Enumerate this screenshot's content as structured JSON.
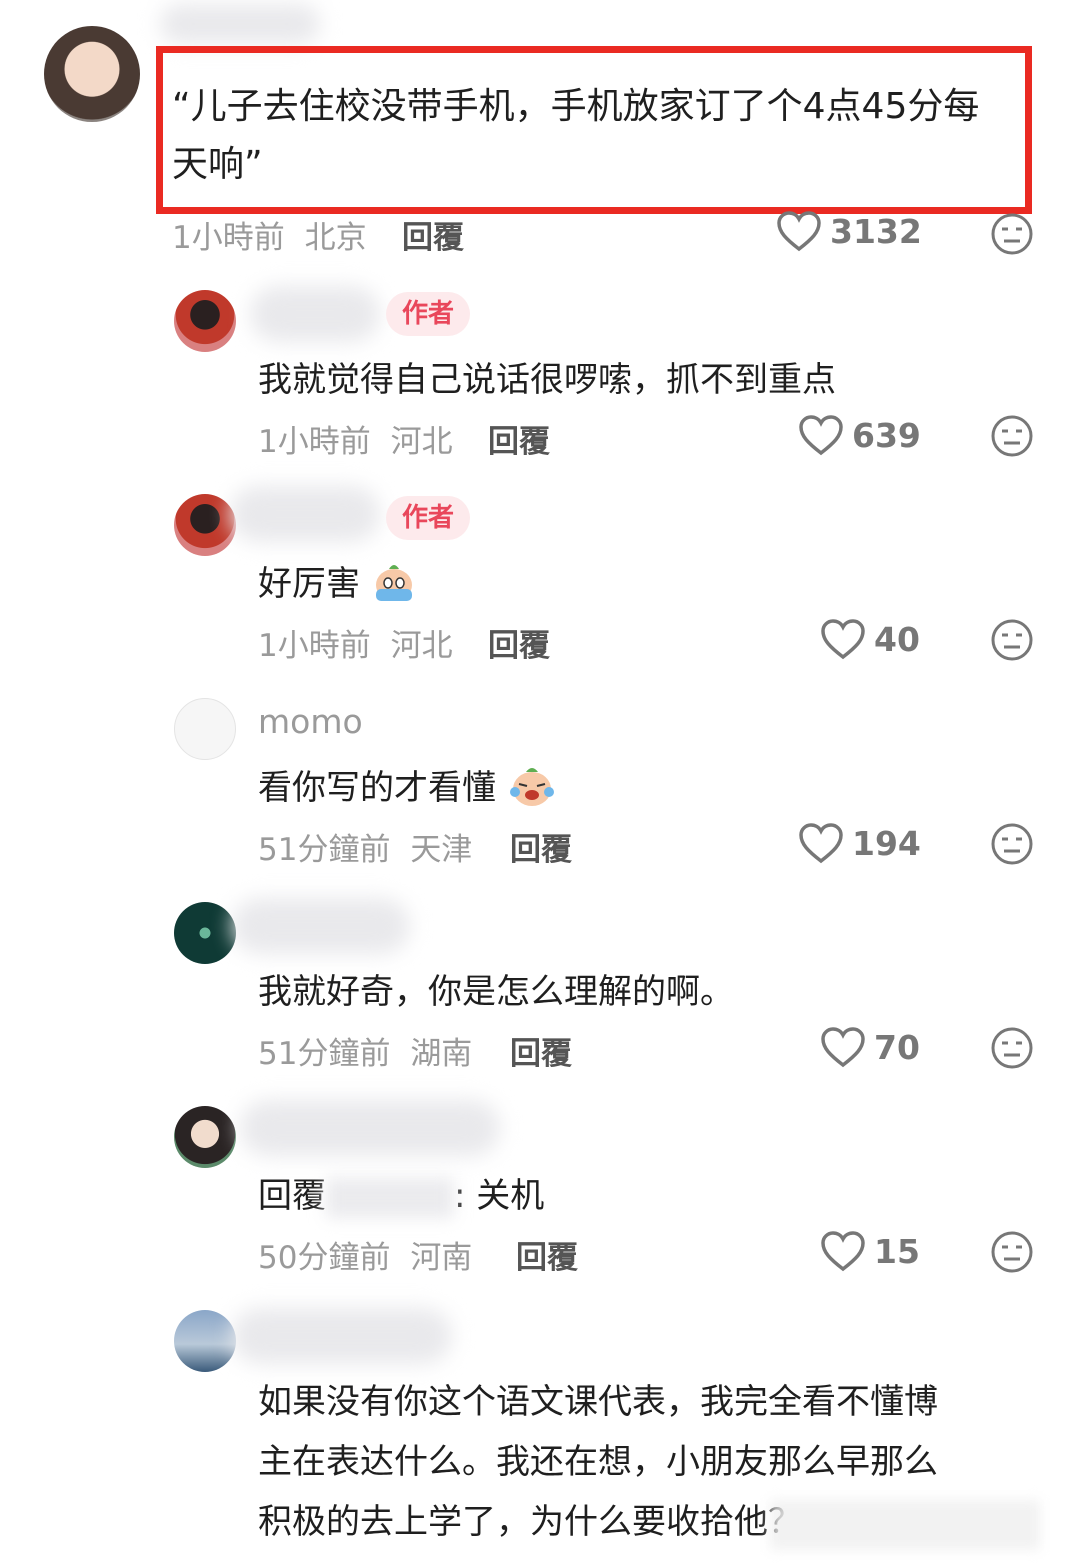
{
  "top_comment": {
    "text_line1": "“儿子去住校没带手机，手机放家订了个4点45分每",
    "text_line2": "天响”",
    "time": "1小時前",
    "location": "北京",
    "reply_label": "回覆",
    "likes": "3132"
  },
  "replies": [
    {
      "badge": "作者",
      "text": "我就觉得自己说话很啰嗦，抓不到重点",
      "time": "1小時前",
      "location": "河北",
      "reply_label": "回覆",
      "likes": "639"
    },
    {
      "badge": "作者",
      "text": "好厉害",
      "time": "1小時前",
      "location": "河北",
      "reply_label": "回覆",
      "likes": "40"
    },
    {
      "username": "momo",
      "text": "看你写的才看懂",
      "time": "51分鐘前",
      "location": "天津",
      "reply_label": "回覆",
      "likes": "194"
    },
    {
      "text": "我就好奇，你是怎么理解的啊。",
      "time": "51分鐘前",
      "location": "湖南",
      "reply_label": "回覆",
      "likes": "70"
    },
    {
      "text_prefix": "回覆",
      "text_suffix": ": 关机",
      "time": "50分鐘前",
      "location": "河南",
      "reply_label": "回覆",
      "likes": "15"
    },
    {
      "text_line1": "如果没有你这个语文课代表，我完全看不懂博",
      "text_line2": "主在表达什么。我还在想，小朋友那么早那么",
      "text_line3": "积极的去上学了，为什么要收拾他？"
    }
  ],
  "colors": {
    "highlight": "#ea2a22",
    "badge_bg": "#fdeaec",
    "badge_text": "#e9475b"
  },
  "icons": [
    "heart-outline-icon",
    "dislike-face-icon",
    "crying-emoji-icon"
  ]
}
